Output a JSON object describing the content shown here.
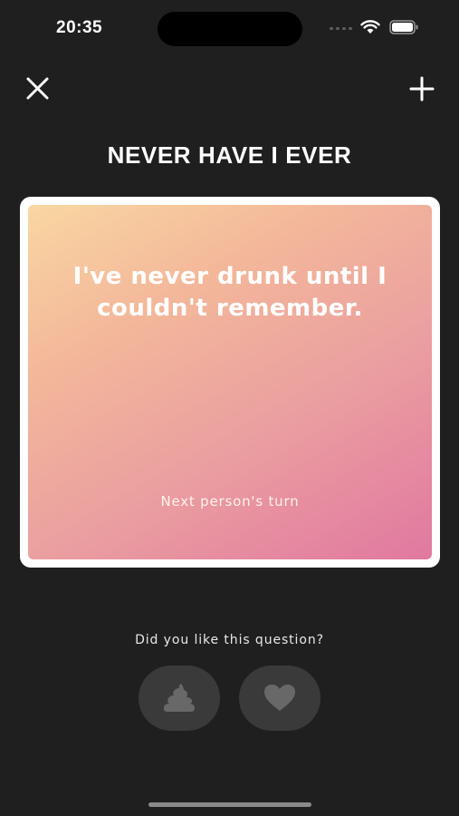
{
  "status_bar": {
    "time": "20:35",
    "icons": [
      "signal-icon",
      "wifi-icon",
      "battery-icon"
    ]
  },
  "header": {
    "close_icon": "close-icon",
    "add_icon": "plus-icon",
    "title": "NEVER HAVE I EVER"
  },
  "card": {
    "question": "I've never drunk until I couldn't remember.",
    "hint": "Next person's turn",
    "gradient": [
      "#f9d7a2",
      "#f3b79a",
      "#eba0a0",
      "#e178a0"
    ]
  },
  "feedback": {
    "prompt": "Did you like this question?",
    "dislike_icon": "poop-icon",
    "like_icon": "heart-icon"
  },
  "colors": {
    "background": "#1f1f1f",
    "button_bg": "#3a3a3a",
    "icon_muted": "#686868"
  }
}
